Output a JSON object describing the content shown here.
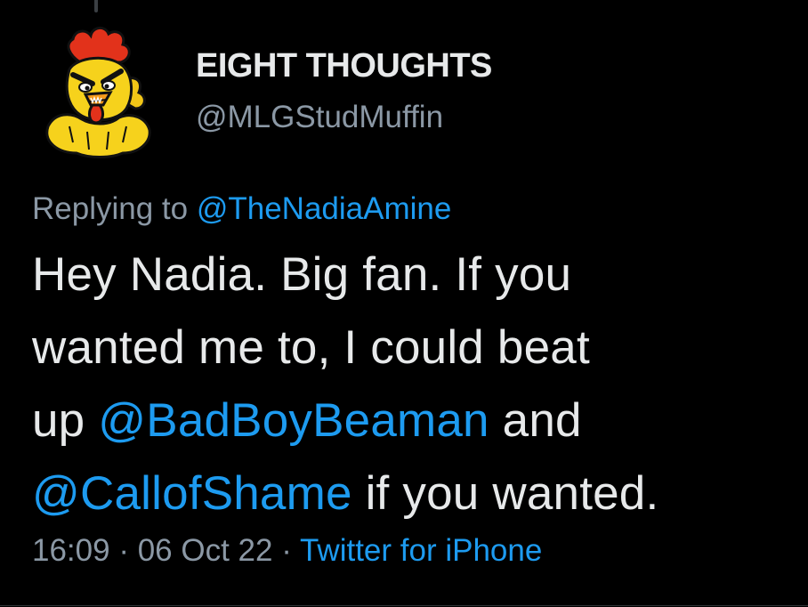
{
  "tweet": {
    "display_name": "EIGHT THOUGHTS",
    "handle": "@MLGStudMuffin",
    "avatar_icon": "angry-rooster-avatar-icon",
    "reply_prefix": "Replying to",
    "reply_to": "@TheNadiaAmine",
    "text_parts": {
      "line1": "Hey Nadia. Big fan. If you",
      "line2": "wanted me to, I could beat",
      "line3_start": "up ",
      "mention1": "@BadBoyBeaman",
      "line3_end": " and",
      "mention2": "@CallofShame",
      "line4_end": " if you wanted."
    },
    "time": "16:09",
    "separator": "·",
    "date": "06 Oct 22",
    "source": "Twitter for iPhone"
  },
  "colors": {
    "background": "#000000",
    "text": "#e7e9ea",
    "secondary_text": "#8b98a5",
    "link": "#1d9bf0"
  }
}
